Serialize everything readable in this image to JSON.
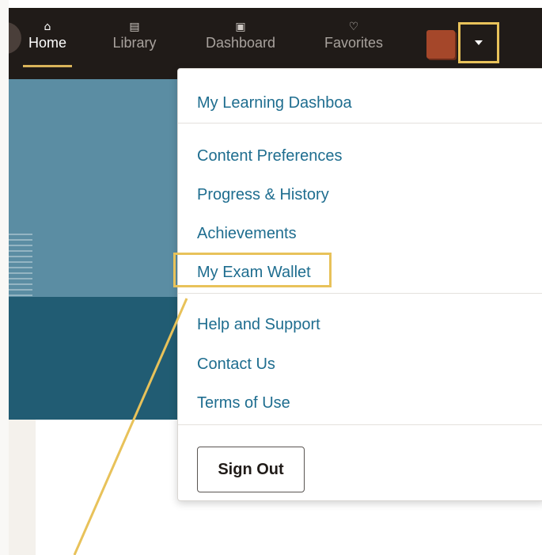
{
  "nav": {
    "items": [
      {
        "label": "Home",
        "icon": "home-icon",
        "active": true
      },
      {
        "label": "Library",
        "icon": "book-icon",
        "active": false
      },
      {
        "label": "Dashboard",
        "icon": "dashboard-icon",
        "active": false
      },
      {
        "label": "Favorites",
        "icon": "heart-icon",
        "active": false
      }
    ]
  },
  "menu": {
    "items": [
      {
        "label": "My Learning Dashboa"
      },
      {
        "label": "Content Preferences"
      },
      {
        "label": "Progress & History"
      },
      {
        "label": "Achievements"
      },
      {
        "label": "My Exam Wallet"
      },
      {
        "label": "Help and Support"
      },
      {
        "label": "Contact Us"
      },
      {
        "label": "Terms of Use"
      }
    ],
    "sign_out_label": "Sign Out"
  },
  "colors": {
    "nav_background": "#201b18",
    "accent_highlight": "#e8c25a",
    "link": "#1e6d8f",
    "hero_light": "#5b8da3",
    "hero_dark": "#215c73",
    "avatar": "#a5472a"
  }
}
